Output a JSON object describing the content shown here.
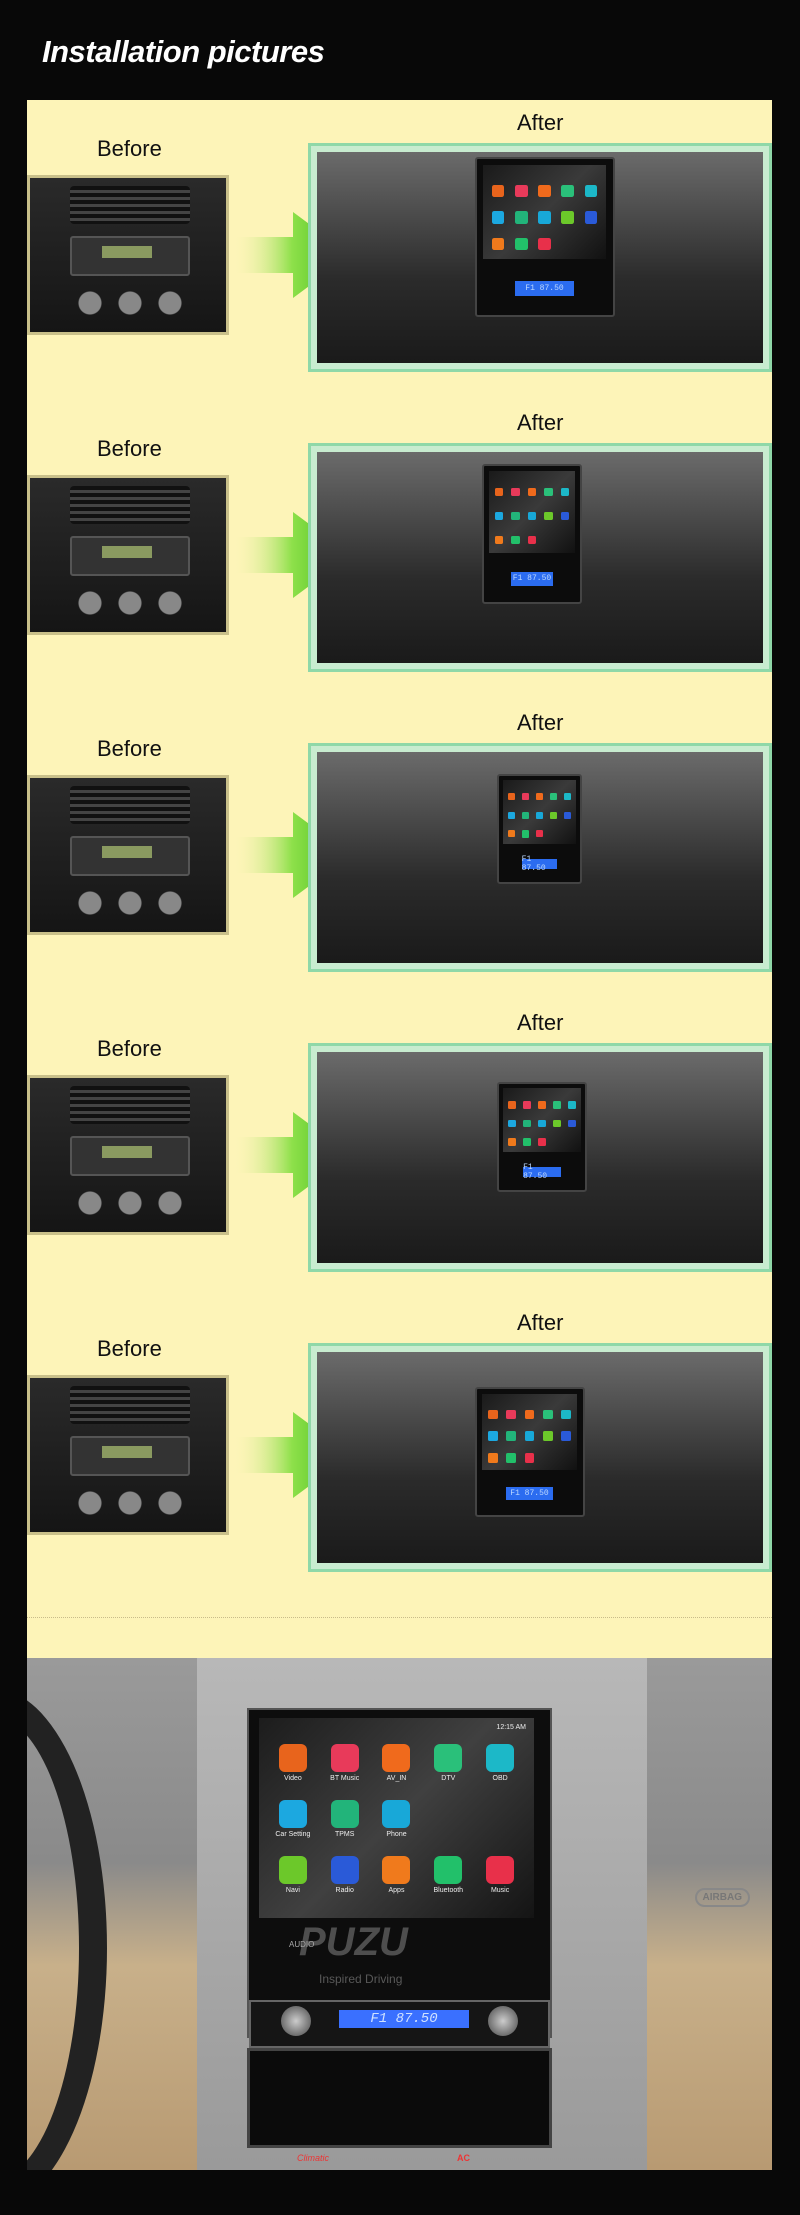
{
  "title": "Installation pictures",
  "colors": {
    "background": "#080808",
    "panel": "#fdf4b8",
    "frame": "#8fd8a8",
    "arrow": "#5ccc1e",
    "lcd": "#3a70ff"
  },
  "rows": [
    {
      "before_label": "Before",
      "after_label": "After",
      "radio_display": "F1 87.50"
    },
    {
      "before_label": "Before",
      "after_label": "After",
      "radio_display": "F1 87.50"
    },
    {
      "before_label": "Before",
      "after_label": "After",
      "radio_display": "F1 87.50"
    },
    {
      "before_label": "Before",
      "after_label": "After",
      "radio_display": "F1 87.50"
    },
    {
      "before_label": "Before",
      "after_label": "After",
      "radio_display": "F1 87.50"
    }
  ],
  "arrow_icon": "green-right-arrow-icon",
  "final_photo": {
    "status_time": "12:15 AM",
    "apps": [
      {
        "label": "Video",
        "color": "#e8641c",
        "icon": "film-icon"
      },
      {
        "label": "BT Music",
        "color": "#e83a5a",
        "icon": "music-note-icon"
      },
      {
        "label": "AV_IN",
        "color": "#f06a1c",
        "icon": "av-plug-icon"
      },
      {
        "label": "DTV",
        "color": "#2ac07a",
        "icon": "tv-icon"
      },
      {
        "label": "OBD",
        "color": "#1cb8c8",
        "icon": "obd-icon"
      },
      {
        "label": "Car Setting",
        "color": "#1ca8e0",
        "icon": "gear-icon"
      },
      {
        "label": "TPMS",
        "color": "#22b47a",
        "icon": "tire-icon"
      },
      {
        "label": "Phone",
        "color": "#18a8d8",
        "icon": "phone-icon"
      },
      {
        "label": "Navi",
        "color": "#6cc82a",
        "icon": "navigation-icon"
      },
      {
        "label": "Radio",
        "color": "#2a5ad8",
        "icon": "radio-icon"
      },
      {
        "label": "Apps",
        "color": "#f07a1c",
        "icon": "apps-grid-icon"
      },
      {
        "label": "Bluetooth",
        "color": "#22c06a",
        "icon": "bluetooth-icon"
      },
      {
        "label": "Music",
        "color": "#e8304a",
        "icon": "music-icon"
      }
    ],
    "brand": "PUZU",
    "audio_label": "AUDIO",
    "tagline": "Inspired Driving",
    "radio_display": "F1  87.50",
    "airbag": "AIRBAG",
    "climatic": "Climatic",
    "ac": "AC"
  }
}
